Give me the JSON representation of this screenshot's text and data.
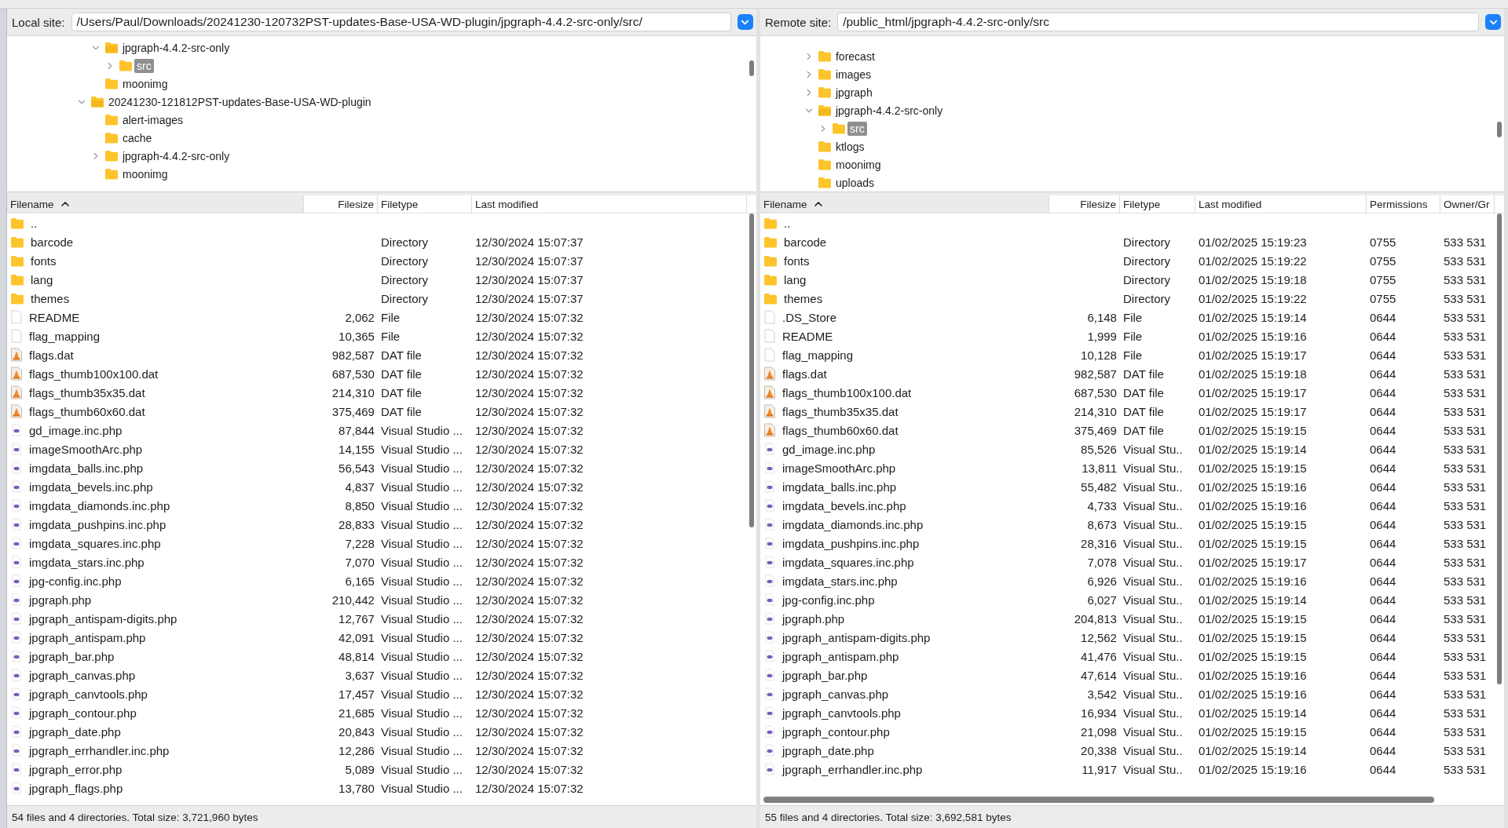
{
  "local": {
    "site_label": "Local site:",
    "path": "/Users/Paul/Downloads/20241230-120732PST-updates-Base-USA-WD-plugin/jpgraph-4.4.2-src-only/src/",
    "tree": {
      "continued": [
        {
          "label": "jpgraph-4.4.2-src-only",
          "expandable": true,
          "expanded": true,
          "selected": false,
          "children": [
            {
              "label": "src",
              "expandable": true,
              "expanded": false,
              "selected": true
            }
          ]
        },
        {
          "label": "moonimg",
          "expandable": false,
          "expanded": false,
          "selected": false
        }
      ],
      "items": [
        {
          "label": "20241230-121812PST-updates-Base-USA-WD-plugin",
          "expandable": true,
          "expanded": true,
          "selected": false,
          "children": [
            {
              "label": "alert-images",
              "expandable": false,
              "expanded": false,
              "selected": false
            },
            {
              "label": "cache",
              "expandable": false,
              "expanded": false,
              "selected": false
            },
            {
              "label": "jpgraph-4.4.2-src-only",
              "expandable": true,
              "expanded": false,
              "selected": false
            },
            {
              "label": "moonimg",
              "expandable": false,
              "expanded": false,
              "selected": false
            }
          ]
        }
      ]
    },
    "columns": [
      {
        "label": "Filename",
        "sorted": true
      },
      {
        "label": "Filesize",
        "sorted": false
      },
      {
        "label": "Filetype",
        "sorted": false
      },
      {
        "label": "Last modified",
        "sorted": false
      }
    ],
    "rows": [
      {
        "kind": "folder",
        "name": ".."
      },
      {
        "kind": "folder",
        "name": "barcode",
        "type": "Directory",
        "modified": "12/30/2024 15:07:37"
      },
      {
        "kind": "folder",
        "name": "fonts",
        "type": "Directory",
        "modified": "12/30/2024 15:07:37"
      },
      {
        "kind": "folder",
        "name": "lang",
        "type": "Directory",
        "modified": "12/30/2024 15:07:37"
      },
      {
        "kind": "folder",
        "name": "themes",
        "type": "Directory",
        "modified": "12/30/2024 15:07:37"
      },
      {
        "kind": "file",
        "name": "README",
        "size": "2,062",
        "type": "File",
        "modified": "12/30/2024 15:07:32"
      },
      {
        "kind": "file",
        "name": "flag_mapping",
        "size": "10,365",
        "type": "File",
        "modified": "12/30/2024 15:07:32"
      },
      {
        "kind": "dat",
        "name": "flags.dat",
        "size": "982,587",
        "type": "DAT file",
        "modified": "12/30/2024 15:07:32"
      },
      {
        "kind": "dat",
        "name": "flags_thumb100x100.dat",
        "size": "687,530",
        "type": "DAT file",
        "modified": "12/30/2024 15:07:32"
      },
      {
        "kind": "dat",
        "name": "flags_thumb35x35.dat",
        "size": "214,310",
        "type": "DAT file",
        "modified": "12/30/2024 15:07:32"
      },
      {
        "kind": "dat",
        "name": "flags_thumb60x60.dat",
        "size": "375,469",
        "type": "DAT file",
        "modified": "12/30/2024 15:07:32"
      },
      {
        "kind": "php",
        "name": "gd_image.inc.php",
        "size": "87,844",
        "type": "Visual Studio ...",
        "modified": "12/30/2024 15:07:32"
      },
      {
        "kind": "php",
        "name": "imageSmoothArc.php",
        "size": "14,155",
        "type": "Visual Studio ...",
        "modified": "12/30/2024 15:07:32"
      },
      {
        "kind": "php",
        "name": "imgdata_balls.inc.php",
        "size": "56,543",
        "type": "Visual Studio ...",
        "modified": "12/30/2024 15:07:32"
      },
      {
        "kind": "php",
        "name": "imgdata_bevels.inc.php",
        "size": "4,837",
        "type": "Visual Studio ...",
        "modified": "12/30/2024 15:07:32"
      },
      {
        "kind": "php",
        "name": "imgdata_diamonds.inc.php",
        "size": "8,850",
        "type": "Visual Studio ...",
        "modified": "12/30/2024 15:07:32"
      },
      {
        "kind": "php",
        "name": "imgdata_pushpins.inc.php",
        "size": "28,833",
        "type": "Visual Studio ...",
        "modified": "12/30/2024 15:07:32"
      },
      {
        "kind": "php",
        "name": "imgdata_squares.inc.php",
        "size": "7,228",
        "type": "Visual Studio ...",
        "modified": "12/30/2024 15:07:32"
      },
      {
        "kind": "php",
        "name": "imgdata_stars.inc.php",
        "size": "7,070",
        "type": "Visual Studio ...",
        "modified": "12/30/2024 15:07:32"
      },
      {
        "kind": "php",
        "name": "jpg-config.inc.php",
        "size": "6,165",
        "type": "Visual Studio ...",
        "modified": "12/30/2024 15:07:32"
      },
      {
        "kind": "php",
        "name": "jpgraph.php",
        "size": "210,442",
        "type": "Visual Studio ...",
        "modified": "12/30/2024 15:07:32"
      },
      {
        "kind": "php",
        "name": "jpgraph_antispam-digits.php",
        "size": "12,767",
        "type": "Visual Studio ...",
        "modified": "12/30/2024 15:07:32"
      },
      {
        "kind": "php",
        "name": "jpgraph_antispam.php",
        "size": "42,091",
        "type": "Visual Studio ...",
        "modified": "12/30/2024 15:07:32"
      },
      {
        "kind": "php",
        "name": "jpgraph_bar.php",
        "size": "48,814",
        "type": "Visual Studio ...",
        "modified": "12/30/2024 15:07:32"
      },
      {
        "kind": "php",
        "name": "jpgraph_canvas.php",
        "size": "3,637",
        "type": "Visual Studio ...",
        "modified": "12/30/2024 15:07:32"
      },
      {
        "kind": "php",
        "name": "jpgraph_canvtools.php",
        "size": "17,457",
        "type": "Visual Studio ...",
        "modified": "12/30/2024 15:07:32"
      },
      {
        "kind": "php",
        "name": "jpgraph_contour.php",
        "size": "21,685",
        "type": "Visual Studio ...",
        "modified": "12/30/2024 15:07:32"
      },
      {
        "kind": "php",
        "name": "jpgraph_date.php",
        "size": "20,843",
        "type": "Visual Studio ...",
        "modified": "12/30/2024 15:07:32"
      },
      {
        "kind": "php",
        "name": "jpgraph_errhandler.inc.php",
        "size": "12,286",
        "type": "Visual Studio ...",
        "modified": "12/30/2024 15:07:32"
      },
      {
        "kind": "php",
        "name": "jpgraph_error.php",
        "size": "5,089",
        "type": "Visual Studio ...",
        "modified": "12/30/2024 15:07:32"
      },
      {
        "kind": "php",
        "name": "jpgraph_flags.php",
        "size": "13,780",
        "type": "Visual Studio ...",
        "modified": "12/30/2024 15:07:32"
      }
    ],
    "status": "54 files and 4 directories. Total size: 3,721,960 bytes"
  },
  "remote": {
    "site_label": "Remote site:",
    "path": "/public_html/jpgraph-4.4.2-src-only/src",
    "tree": {
      "items": [
        {
          "label": "forecast",
          "expandable": true,
          "expanded": false,
          "selected": false
        },
        {
          "label": "images",
          "expandable": true,
          "expanded": false,
          "selected": false
        },
        {
          "label": "jpgraph",
          "expandable": true,
          "expanded": false,
          "selected": false
        },
        {
          "label": "jpgraph-4.4.2-src-only",
          "expandable": true,
          "expanded": true,
          "selected": false,
          "children": [
            {
              "label": "src",
              "expandable": true,
              "expanded": false,
              "selected": true
            }
          ]
        },
        {
          "label": "ktlogs",
          "expandable": false,
          "expanded": false,
          "selected": false
        },
        {
          "label": "moonimg",
          "expandable": false,
          "expanded": false,
          "selected": false
        },
        {
          "label": "uploads",
          "expandable": false,
          "expanded": false,
          "selected": false
        }
      ]
    },
    "columns": [
      {
        "label": "Filename",
        "sorted": true
      },
      {
        "label": "Filesize",
        "sorted": false
      },
      {
        "label": "Filetype",
        "sorted": false
      },
      {
        "label": "Last modified",
        "sorted": false
      },
      {
        "label": "Permissions",
        "sorted": false
      },
      {
        "label": "Owner/Gr",
        "sorted": false
      }
    ],
    "rows": [
      {
        "kind": "folder",
        "name": ".."
      },
      {
        "kind": "folder",
        "name": "barcode",
        "type": "Directory",
        "modified": "01/02/2025 15:19:23",
        "permissions": "0755",
        "owner": "533 531"
      },
      {
        "kind": "folder",
        "name": "fonts",
        "type": "Directory",
        "modified": "01/02/2025 15:19:22",
        "permissions": "0755",
        "owner": "533 531"
      },
      {
        "kind": "folder",
        "name": "lang",
        "type": "Directory",
        "modified": "01/02/2025 15:19:18",
        "permissions": "0755",
        "owner": "533 531"
      },
      {
        "kind": "folder",
        "name": "themes",
        "type": "Directory",
        "modified": "01/02/2025 15:19:22",
        "permissions": "0755",
        "owner": "533 531"
      },
      {
        "kind": "file",
        "name": ".DS_Store",
        "size": "6,148",
        "type": "File",
        "modified": "01/02/2025 15:19:14",
        "permissions": "0644",
        "owner": "533 531"
      },
      {
        "kind": "file",
        "name": "README",
        "size": "1,999",
        "type": "File",
        "modified": "01/02/2025 15:19:16",
        "permissions": "0644",
        "owner": "533 531"
      },
      {
        "kind": "file",
        "name": "flag_mapping",
        "size": "10,128",
        "type": "File",
        "modified": "01/02/2025 15:19:17",
        "permissions": "0644",
        "owner": "533 531"
      },
      {
        "kind": "dat",
        "name": "flags.dat",
        "size": "982,587",
        "type": "DAT file",
        "modified": "01/02/2025 15:19:18",
        "permissions": "0644",
        "owner": "533 531"
      },
      {
        "kind": "dat",
        "name": "flags_thumb100x100.dat",
        "size": "687,530",
        "type": "DAT file",
        "modified": "01/02/2025 15:19:17",
        "permissions": "0644",
        "owner": "533 531"
      },
      {
        "kind": "dat",
        "name": "flags_thumb35x35.dat",
        "size": "214,310",
        "type": "DAT file",
        "modified": "01/02/2025 15:19:17",
        "permissions": "0644",
        "owner": "533 531"
      },
      {
        "kind": "dat",
        "name": "flags_thumb60x60.dat",
        "size": "375,469",
        "type": "DAT file",
        "modified": "01/02/2025 15:19:15",
        "permissions": "0644",
        "owner": "533 531"
      },
      {
        "kind": "php",
        "name": "gd_image.inc.php",
        "size": "85,526",
        "type": "Visual Stu..",
        "modified": "01/02/2025 15:19:14",
        "permissions": "0644",
        "owner": "533 531"
      },
      {
        "kind": "php",
        "name": "imageSmoothArc.php",
        "size": "13,811",
        "type": "Visual Stu..",
        "modified": "01/02/2025 15:19:15",
        "permissions": "0644",
        "owner": "533 531"
      },
      {
        "kind": "php",
        "name": "imgdata_balls.inc.php",
        "size": "55,482",
        "type": "Visual Stu..",
        "modified": "01/02/2025 15:19:16",
        "permissions": "0644",
        "owner": "533 531"
      },
      {
        "kind": "php",
        "name": "imgdata_bevels.inc.php",
        "size": "4,733",
        "type": "Visual Stu..",
        "modified": "01/02/2025 15:19:16",
        "permissions": "0644",
        "owner": "533 531"
      },
      {
        "kind": "php",
        "name": "imgdata_diamonds.inc.php",
        "size": "8,673",
        "type": "Visual Stu..",
        "modified": "01/02/2025 15:19:15",
        "permissions": "0644",
        "owner": "533 531"
      },
      {
        "kind": "php",
        "name": "imgdata_pushpins.inc.php",
        "size": "28,316",
        "type": "Visual Stu..",
        "modified": "01/02/2025 15:19:15",
        "permissions": "0644",
        "owner": "533 531"
      },
      {
        "kind": "php",
        "name": "imgdata_squares.inc.php",
        "size": "7,078",
        "type": "Visual Stu..",
        "modified": "01/02/2025 15:19:17",
        "permissions": "0644",
        "owner": "533 531"
      },
      {
        "kind": "php",
        "name": "imgdata_stars.inc.php",
        "size": "6,926",
        "type": "Visual Stu..",
        "modified": "01/02/2025 15:19:16",
        "permissions": "0644",
        "owner": "533 531"
      },
      {
        "kind": "php",
        "name": "jpg-config.inc.php",
        "size": "6,027",
        "type": "Visual Stu..",
        "modified": "01/02/2025 15:19:14",
        "permissions": "0644",
        "owner": "533 531"
      },
      {
        "kind": "php",
        "name": "jpgraph.php",
        "size": "204,813",
        "type": "Visual Stu..",
        "modified": "01/02/2025 15:19:15",
        "permissions": "0644",
        "owner": "533 531"
      },
      {
        "kind": "php",
        "name": "jpgraph_antispam-digits.php",
        "size": "12,562",
        "type": "Visual Stu..",
        "modified": "01/02/2025 15:19:15",
        "permissions": "0644",
        "owner": "533 531"
      },
      {
        "kind": "php",
        "name": "jpgraph_antispam.php",
        "size": "41,476",
        "type": "Visual Stu..",
        "modified": "01/02/2025 15:19:15",
        "permissions": "0644",
        "owner": "533 531"
      },
      {
        "kind": "php",
        "name": "jpgraph_bar.php",
        "size": "47,614",
        "type": "Visual Stu..",
        "modified": "01/02/2025 15:19:16",
        "permissions": "0644",
        "owner": "533 531"
      },
      {
        "kind": "php",
        "name": "jpgraph_canvas.php",
        "size": "3,542",
        "type": "Visual Stu..",
        "modified": "01/02/2025 15:19:16",
        "permissions": "0644",
        "owner": "533 531"
      },
      {
        "kind": "php",
        "name": "jpgraph_canvtools.php",
        "size": "16,934",
        "type": "Visual Stu..",
        "modified": "01/02/2025 15:19:14",
        "permissions": "0644",
        "owner": "533 531"
      },
      {
        "kind": "php",
        "name": "jpgraph_contour.php",
        "size": "21,098",
        "type": "Visual Stu..",
        "modified": "01/02/2025 15:19:15",
        "permissions": "0644",
        "owner": "533 531"
      },
      {
        "kind": "php",
        "name": "jpgraph_date.php",
        "size": "20,338",
        "type": "Visual Stu..",
        "modified": "01/02/2025 15:19:14",
        "permissions": "0644",
        "owner": "533 531"
      },
      {
        "kind": "php",
        "name": "jpgraph_errhandler.inc.php",
        "size": "11,917",
        "type": "Visual Stu..",
        "modified": "01/02/2025 15:19:16",
        "permissions": "0644",
        "owner": "533 531"
      }
    ],
    "status": "55 files and 4 directories. Total size: 3,692,581 bytes"
  }
}
